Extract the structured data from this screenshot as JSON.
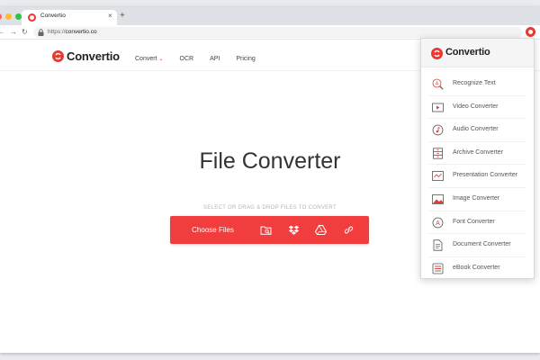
{
  "browser": {
    "tab_title": "Convertio",
    "tab_close": "×",
    "new_tab": "+",
    "url_scheme": "https://",
    "url_host": "convertio.co",
    "back": "←",
    "forward": "→",
    "reload": "↻"
  },
  "header": {
    "logo": "Convertio",
    "nav": [
      {
        "label": "Convert",
        "has_dropdown": true
      },
      {
        "label": "OCR"
      },
      {
        "label": "API"
      },
      {
        "label": "Pricing"
      }
    ]
  },
  "main": {
    "title": "File Converter",
    "hint": "SELECT OR DRAG & DROP FILES TO CONVERT",
    "choose_label": "Choose Files"
  },
  "dropdown": {
    "logo": "Convertio",
    "items": [
      {
        "label": "Recognize Text",
        "icon": "magnifier-icon"
      },
      {
        "label": "Video Converter",
        "icon": "video-icon"
      },
      {
        "label": "Audio Converter",
        "icon": "audio-icon"
      },
      {
        "label": "Archive Converter",
        "icon": "archive-icon"
      },
      {
        "label": "Presentation Converter",
        "icon": "presentation-icon"
      },
      {
        "label": "Image Converter",
        "icon": "image-icon"
      },
      {
        "label": "Font Converter",
        "icon": "font-icon"
      },
      {
        "label": "Document Converter",
        "icon": "document-icon"
      },
      {
        "label": "eBook Converter",
        "icon": "ebook-icon"
      }
    ]
  },
  "colors": {
    "brand": "#e63a35",
    "button": "#f13d3d",
    "traffic_red": "#ff5f57",
    "traffic_yellow": "#febc2e",
    "traffic_green": "#28c840"
  }
}
